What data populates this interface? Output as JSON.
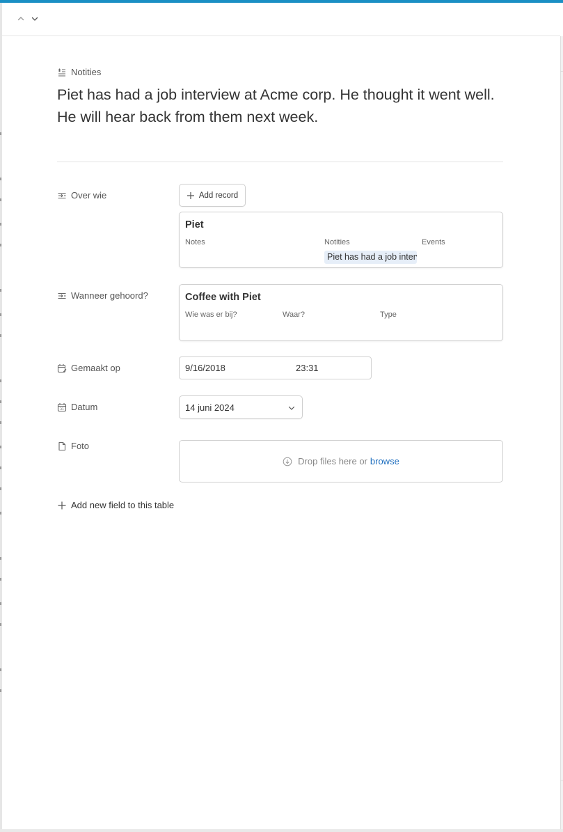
{
  "header": {
    "prev_icon": "chevron-up-icon",
    "next_icon": "chevron-down-icon"
  },
  "notes_field": {
    "label": "Notities",
    "icon": "long-text-icon",
    "value": "Piet has had a job interview at Acme corp. He thought it went well. He will hear back from them next week."
  },
  "over_wie": {
    "label": "Over wie",
    "icon": "linked-record-icon",
    "add_button_label": "Add record",
    "card": {
      "title": "Piet",
      "columns": [
        "Notes",
        "Notities",
        "Events"
      ],
      "chip": "Piet has had a job interview at Acme corp."
    }
  },
  "wanneer": {
    "label": "Wanneer gehoord?",
    "icon": "linked-record-icon",
    "card": {
      "title": "Coffee with Piet",
      "columns": [
        "Wie was er bij?",
        "Waar?",
        "Type"
      ]
    }
  },
  "gemaakt_op": {
    "label": "Gemaakt op",
    "icon": "calendar-edit-icon",
    "date": "9/16/2018",
    "time": "23:31"
  },
  "datum": {
    "label": "Datum",
    "icon": "calendar-icon",
    "value": "14 juni 2024"
  },
  "foto": {
    "label": "Foto",
    "icon": "file-icon",
    "drop_text": "Drop files here or",
    "browse_label": "browse"
  },
  "add_field_label": "Add new field to this table",
  "colors": {
    "accent_bar": "#1a8fc4",
    "link": "#1f6fbf",
    "chip_bg": "#e6eef8"
  }
}
